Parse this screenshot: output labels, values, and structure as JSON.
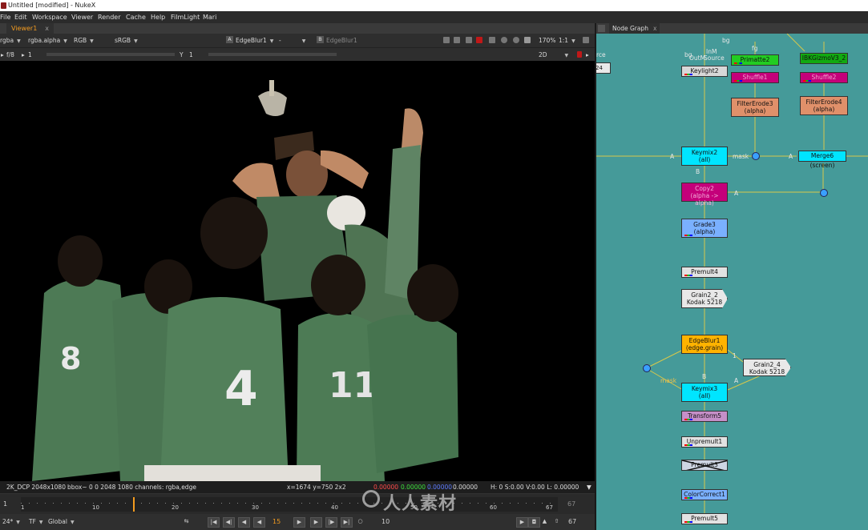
{
  "window": {
    "title": "Untitled [modified] - NukeX"
  },
  "menu": [
    "File",
    "Edit",
    "Workspace",
    "Viewer",
    "Render",
    "Cache",
    "Help",
    "FilmLight",
    "Mari"
  ],
  "viewer": {
    "tab_label": "Viewer1",
    "tab_close": "x",
    "channels": "rgba",
    "layer": "rgba.alpha",
    "display": "RGB",
    "lut": "sRGB",
    "input_a_label": "A",
    "input_a": "EdgeBlur1",
    "composite": "-",
    "input_b_label": "B",
    "input_b": "EdgeBlur1",
    "zoom": "170%",
    "ratio": "1:1",
    "fstop": "f/8",
    "gain_value": "1",
    "gamma_label": "Y",
    "gamma_value": "1",
    "view_mode": "2D"
  },
  "infobar": {
    "format": "2K_DCP 2048x1080",
    "bbox": "bbox~ 0 0 2048 1080 channels: rgba,edge",
    "coords": "x=1674 y=750 2x2",
    "r": "0.00000",
    "g": "0.00000",
    "b": "0.00000",
    "a": "0.00000",
    "hsv": "H:   0 S:0.00 V:0.00  L: 0.00000"
  },
  "timeline": {
    "start": "1",
    "end": "67",
    "ticks": [
      "1",
      "10",
      "20",
      "30",
      "40",
      "50",
      "60",
      "67"
    ],
    "current_frame": "15",
    "step": "10",
    "frame_display": "67",
    "fps": "24*",
    "time_format": "TF",
    "range_mode": "Global"
  },
  "node_graph": {
    "tab_label": "Node Graph",
    "tab_close": "x",
    "left_cut_labels": [
      "rce",
      "24"
    ],
    "nodes": {
      "keylight2": "Keylight2",
      "primatte2": "Primatte2",
      "ibk": "IBKGizmoV3_2",
      "shuffle1": "Shuffle1",
      "shuffle2": "Shuffle2",
      "filtererode3": "FilterErode3",
      "filtererode3_sub": "(alpha)",
      "filtererode4": "FilterErode4",
      "filtererode4_sub": "(alpha)",
      "keymix2": "Keymix2",
      "keymix2_sub": "(all)",
      "merge6": "Merge6 (screen)",
      "copy2": "Copy2",
      "copy2_sub": "(alpha -> alpha)",
      "grade3": "Grade3",
      "grade3_sub": "(alpha)",
      "premult4": "Premult4",
      "grain2_2": "Grain2_2",
      "grain2_2_sub": "Kodak 5218",
      "edgeblur1": "EdgeBlur1",
      "edgeblur1_sub": "(edge.grain)",
      "grain2_4": "Grain2_4",
      "grain2_4_sub": "Kodak 5218",
      "keymix3": "Keymix3",
      "keymix3_sub": "(all)",
      "transform5": "Transform5",
      "unpremult1": "Unpremult1",
      "disabled": "Premult3",
      "colorcorrect1": "ColorCorrect1",
      "premult5": "Premult5"
    },
    "wire_labels": {
      "bg1": "bg",
      "fg1": "fg",
      "bg2": "bg",
      "inm": "InM",
      "outm": "OutM",
      "source": "Source",
      "a1": "A",
      "mask1": "mask",
      "a2": "A",
      "b1": "B",
      "a3": "A",
      "b2": "B",
      "a4": "A",
      "mask2": "mask",
      "one": "1"
    }
  },
  "watermark": "人人素材",
  "colors": {
    "node_graph_bg": "#459a99",
    "accent_tab": "#f39b1f",
    "keymix": "#00e5ff",
    "primatte": "#22cc22",
    "shuffle": "#c4007a",
    "filtererode": "#e0906a",
    "grade": "#7ab0ff",
    "edgeblur": "#ffb300"
  }
}
